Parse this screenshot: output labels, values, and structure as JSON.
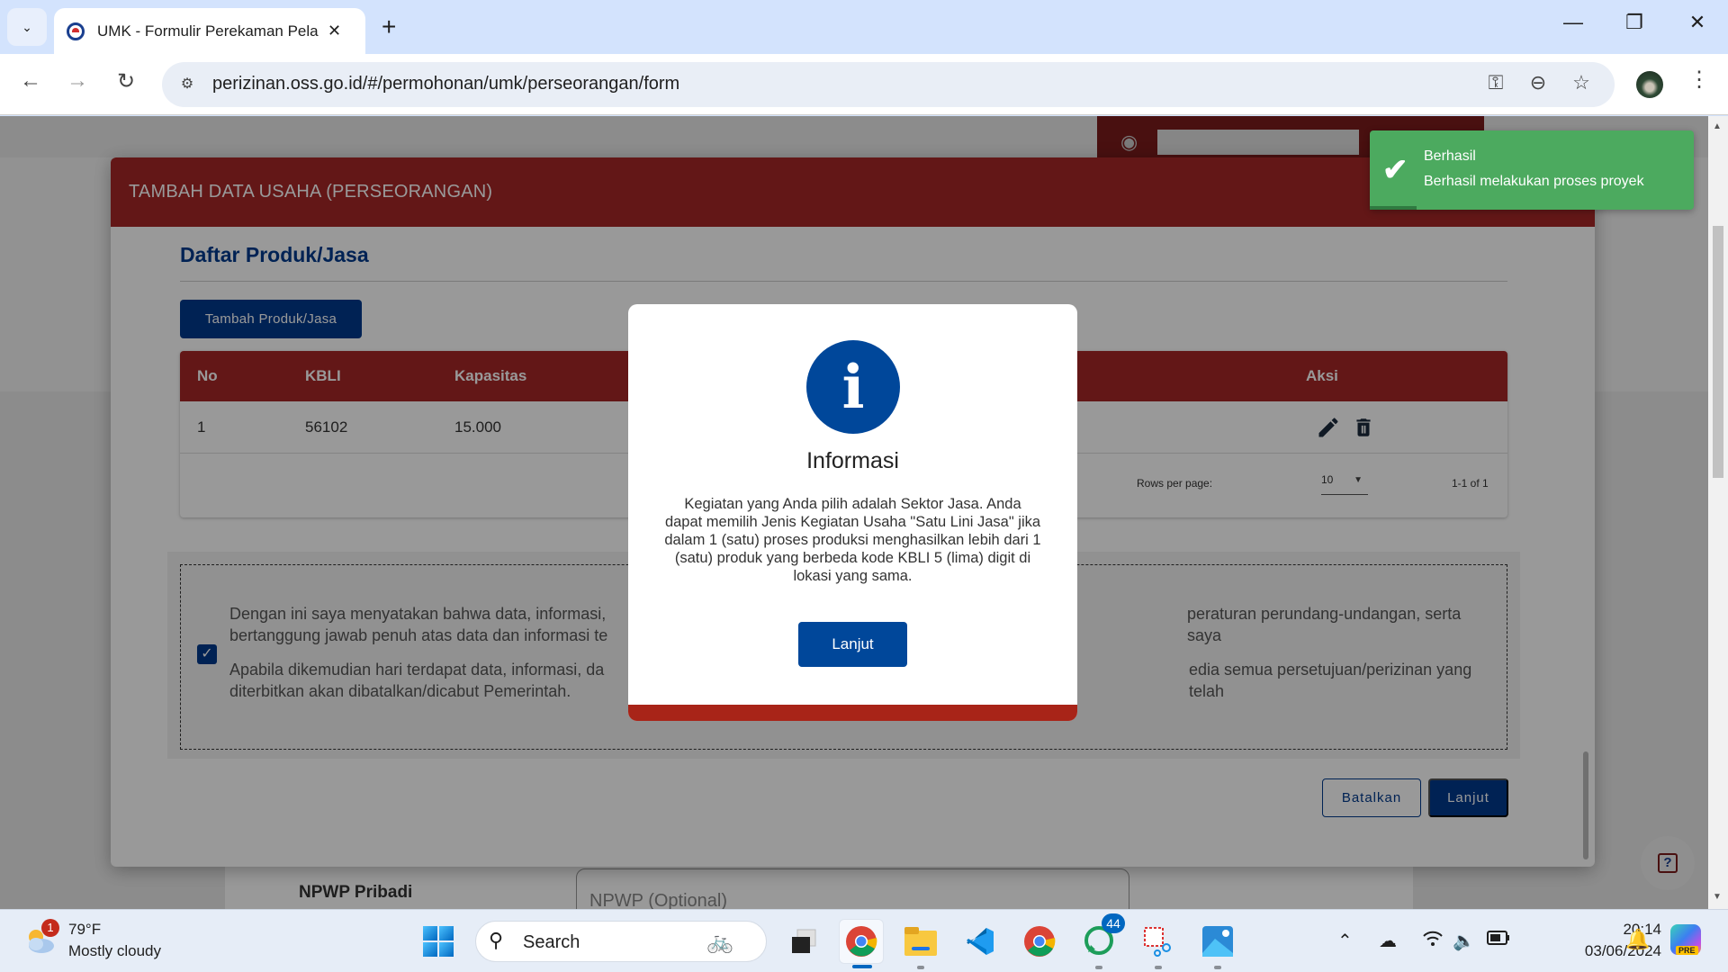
{
  "browser": {
    "tab_title": "UMK - Formulir Perekaman Pela",
    "url": "perizinan.oss.go.id/#/permohonan/umk/perseorangan/form",
    "new_tab": "+",
    "tab_close": "✕"
  },
  "form_modal": {
    "title": "TAMBAH DATA USAHA (PERSEORANGAN)",
    "section_title": "Daftar Produk/Jasa",
    "add_button": "Tambah Produk/Jasa",
    "table": {
      "columns": [
        "No",
        "KBLI",
        "Kapasitas",
        "Aksi"
      ],
      "rows": [
        {
          "no": "1",
          "kbli": "56102",
          "kapasitas": "15.000"
        }
      ],
      "rows_per_page_label": "Rows per page:",
      "rows_per_page_value": "10",
      "range_label": "1-1 of 1"
    },
    "declaration": {
      "checked": true,
      "line1": "Dengan ini saya menyatakan bahwa data, informasi, [tertutup dialog] peraturan perundang-undangan, serta saya",
      "line1_left": "Dengan ini saya menyatakan bahwa data, informasi,",
      "line1_right": "peraturan perundang-undangan, serta saya",
      "line2_left": "bertanggung jawab penuh atas data dan informasi te",
      "line3_left": "Apabila dikemudian hari terdapat data, informasi, da",
      "line3_right": "edia semua persetujuan/perizinan yang telah",
      "line4_left": "diterbitkan akan dibatalkan/dicabut Pemerintah."
    },
    "cancel_button": "Batalkan",
    "next_button": "Lanjut"
  },
  "background_page": {
    "npwp_label": "NPWP Pribadi",
    "npwp_placeholder": "NPWP (Optional)",
    "help_icon": "?"
  },
  "info_dialog": {
    "icon": "i",
    "title": "Informasi",
    "message": "Kegiatan yang Anda pilih adalah Sektor Jasa. Anda dapat memilih Jenis Kegiatan Usaha \"Satu Lini Jasa\" jika dalam 1 (satu) proses produksi menghasilkan lebih dari 1 (satu) produk yang berbeda kode KBLI 5 (lima) digit di lokasi yang sama.",
    "button": "Lanjut"
  },
  "toast": {
    "title": "Berhasil",
    "message": "Berhasil melakukan proses proyek",
    "color": "#4caa5f"
  },
  "taskbar": {
    "weather_badge": "1",
    "temperature": "79°F",
    "weather": "Mostly cloudy",
    "search_label": "Search",
    "whatsapp_badge": "44",
    "time": "20:14",
    "date": "03/06/2024",
    "copilot_tag": "PRE"
  },
  "colors": {
    "brand_red": "#a52727",
    "brand_blue": "#003a8c",
    "info_blue": "#00479a"
  }
}
